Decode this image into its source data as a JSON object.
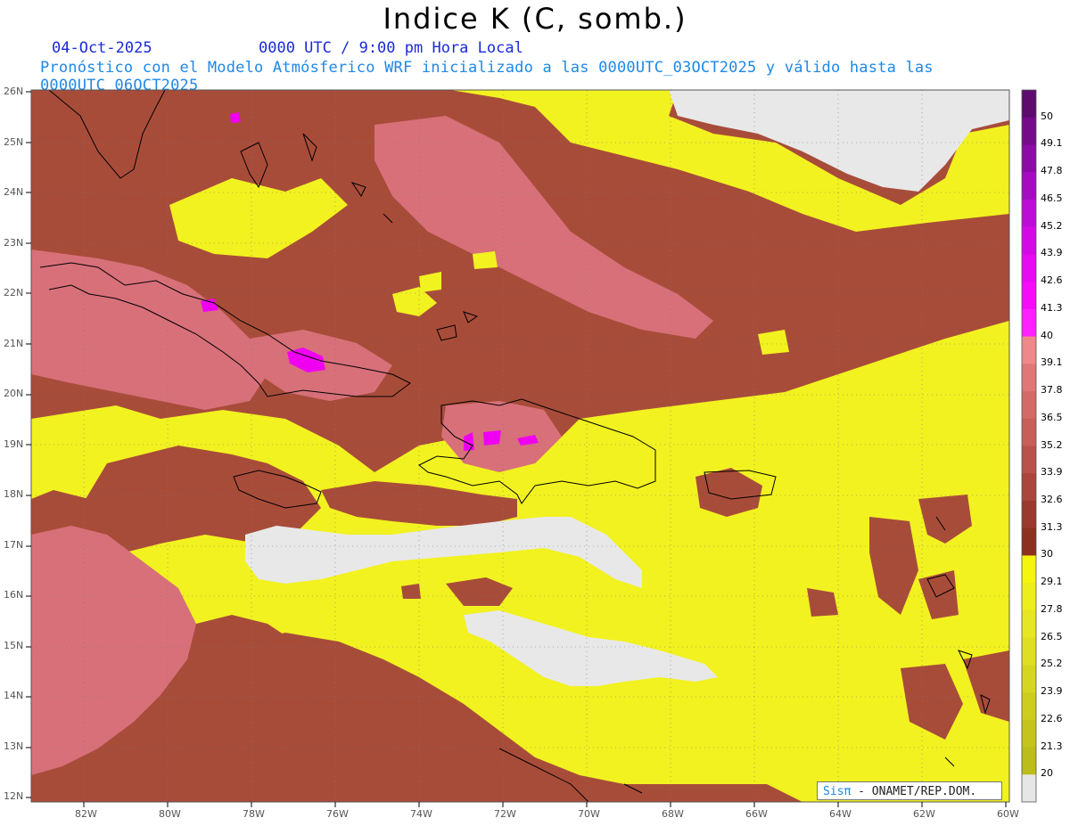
{
  "header": {
    "title": "Indice K (C, somb.)",
    "date": "04-Oct-2025",
    "valid_time": "0000 UTC / 9:00 pm Hora Local",
    "description": "Pronóstico con el Modelo Atmósferico WRF inicializado a las 0000UTC_03OCT2025 y válido hasta las  0000UTC_06OCT2025"
  },
  "map": {
    "lat_labels": [
      "26N",
      "25N",
      "24N",
      "23N",
      "22N",
      "21N",
      "20N",
      "19N",
      "18N",
      "17N",
      "16N",
      "15N",
      "14N",
      "13N",
      "12N"
    ],
    "lon_labels": [
      "82W",
      "80W",
      "78W",
      "76W",
      "74W",
      "72W",
      "70W",
      "68W",
      "66W",
      "64W",
      "62W",
      "60W"
    ],
    "colors": {
      "low": "#f2f220",
      "mid": "#a84c3a",
      "high": "#d8707a",
      "missing": "#e8e8e8",
      "peak": "#f000f0"
    }
  },
  "colorbar": {
    "labels": [
      "50",
      "49.1",
      "47.8",
      "46.5",
      "45.2",
      "43.9",
      "42.6",
      "41.3",
      "40",
      "39.1",
      "37.8",
      "36.5",
      "35.2",
      "33.9",
      "32.6",
      "31.3",
      "30",
      "29.1",
      "27.8",
      "26.5",
      "25.2",
      "23.9",
      "22.6",
      "21.3",
      "20"
    ],
    "colors": [
      "#5e0a6e",
      "#750a8a",
      "#8c0aa6",
      "#a50cc2",
      "#be0cd8",
      "#d40ae6",
      "#e80af0",
      "#f60af8",
      "#ff20ff",
      "#ef8888",
      "#e07676",
      "#d46a66",
      "#c75e58",
      "#b9524a",
      "#aa463c",
      "#9a3a2e",
      "#8c3020",
      "#f5f50e",
      "#eeee18",
      "#e6e622",
      "#dede22",
      "#d6d620",
      "#cdcd1e",
      "#c4c41c",
      "#bcbc1a"
    ],
    "missing_color": "#e6e6e6"
  },
  "logo": {
    "sis": "Sisπ",
    "rest": "- ONAMET/REP.DOM."
  }
}
